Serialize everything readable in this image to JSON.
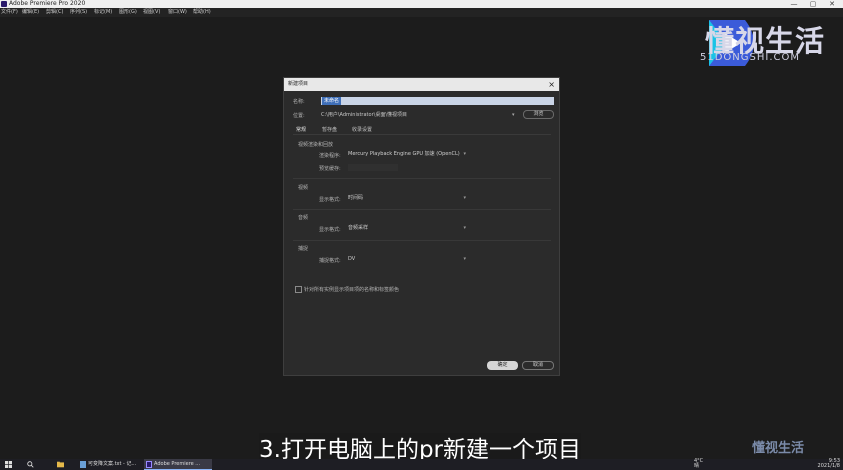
{
  "window": {
    "title": "Adobe Premiere Pro 2020",
    "controls": [
      "—",
      "▢",
      "✕"
    ]
  },
  "menubar": [
    "文件(F)",
    "编辑(E)",
    "剪辑(C)",
    "序列(S)",
    "标记(M)",
    "图形(G)",
    "视图(V)",
    "窗口(W)",
    "帮助(H)"
  ],
  "logo": {
    "text": "懂视生活",
    "sub": "51DONGSHI.COM"
  },
  "dialog": {
    "title": "新建项目",
    "name_label": "名称:",
    "name_value": "未命名",
    "location_label": "位置:",
    "location_value": "C:\\用户\\Administrator\\桌面\\懂视项目",
    "browse_label": "浏览",
    "tabs": [
      "常规",
      "暂存盘",
      "收录设置"
    ],
    "renderer_section": "视频渲染和回放",
    "renderer_label": "渲染程序:",
    "renderer_value": "Mercury Playback Engine GPU 加速 (OpenCL)",
    "preview_cache_label": "预览缓存:",
    "video_section": "视频",
    "video_display_label": "显示格式:",
    "video_display_value": "时间码",
    "audio_section": "音频",
    "audio_display_label": "显示格式:",
    "audio_display_value": "音频采样",
    "capture_section": "捕捉",
    "capture_format_label": "捕捉格式:",
    "capture_format_value": "DV",
    "checkbox_label": "针对所有实例显示项目项的名称和标签颜色",
    "ok_label": "确定",
    "cancel_label": "取消"
  },
  "caption": "3.打开电脑上的pr新建一个项目",
  "taskbar": {
    "items": [
      {
        "label": "可变降文案.txt - 记..."
      },
      {
        "label": "Adobe Premiere ..."
      }
    ],
    "weather": "4°C",
    "weather_sub": "晴",
    "time": "9:53",
    "date": "2021/1/8"
  },
  "colors": {
    "background": "#1c1c1c",
    "dialog": "#2b2b2b",
    "selection": "#3f6fb8"
  }
}
